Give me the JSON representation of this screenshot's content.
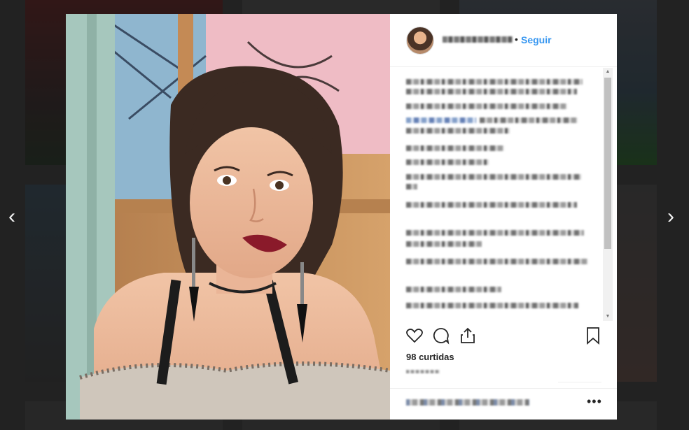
{
  "navigation": {
    "prev_glyph": "‹",
    "next_glyph": "›"
  },
  "post": {
    "header": {
      "follow_label": "Seguir",
      "separator": "•"
    },
    "likes_text": "98 curtidas",
    "more_label": "•••"
  },
  "icons": {
    "like": "heart-icon",
    "comment": "comment-icon",
    "share": "share-icon",
    "save": "bookmark-icon"
  },
  "colors": {
    "accent": "#3897f0",
    "text": "#262626",
    "backdrop": "#3f3f3f"
  }
}
